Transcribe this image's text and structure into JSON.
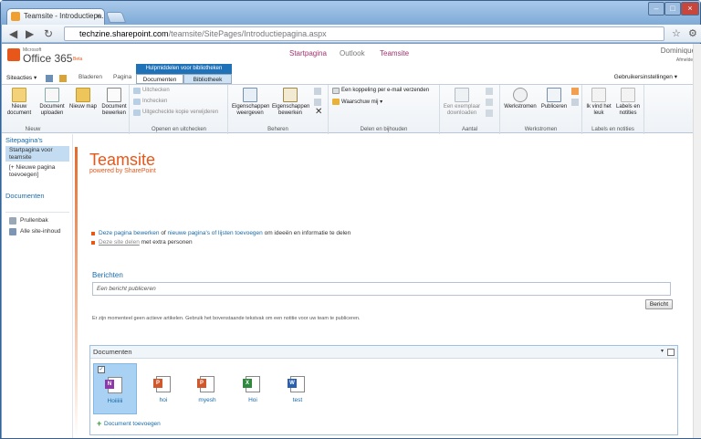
{
  "browser": {
    "tab_title": "Teamsite - Introductiepa...",
    "url_domain": "techzine.sharepoint.com",
    "url_path": "/teamsite/SitePages/Introductiepagina.aspx"
  },
  "o365": {
    "ms_label": "Microsoft",
    "product": "Office 365",
    "beta": "Beta",
    "nav": [
      "Startpagina",
      "Outlook",
      "Teamsite"
    ],
    "user_name": "Dominique",
    "signout": "Afmelden"
  },
  "ribbon_tabs": {
    "siteacties": "Siteacties",
    "bladeren": "Bladeren",
    "pagina": "Pagina",
    "context_group": "Hulpmiddelen voor bibliotheken",
    "documenten": "Documenten",
    "bibliotheek": "Bibliotheek",
    "user_settings": "Gebruikersinstellingen"
  },
  "ribbon": {
    "nieuw_doc": "Nieuw document",
    "doc_uploaden": "Document uploaden",
    "nieuw_map": "Nieuw map",
    "doc_bewerken": "Document bewerken",
    "uitchecken": "Uitchecken",
    "inchecken": "Inchecken",
    "uitgecheckt": "Uitgecheckte kopie verwijderen",
    "eig_weergeven": "Eigenschappen weergeven",
    "eig_bewerken": "Eigenschappen bewerken",
    "koppeling": "Een koppeling per e-mail verzenden",
    "waarschuw": "Waarschuw mij",
    "exemplaar": "Een exemplaar downloaden",
    "werkstromen": "Werkstromen",
    "publiceren": "Publiceren",
    "leuk": "Ik vind het leuk",
    "labels": "Labels en notities",
    "groups": {
      "nieuw": "Nieuw",
      "openen": "Openen en uitchecken",
      "beheren": "Beheren",
      "delen": "Delen en bijhouden",
      "aantal": "Aantal",
      "werkstromen": "Werkstromen",
      "labels": "Labels en notities"
    }
  },
  "left_nav": {
    "sitepaginas": "Sitepagina's",
    "startpagina": "Startpagina voor teamsite",
    "nieuwe_pagina": "[+ Nieuwe pagina toevoegen]",
    "documenten": "Documenten",
    "prullenbak": "Prullenbak",
    "alle": "Alle site-inhoud"
  },
  "main": {
    "title": "Teamsite",
    "powered": "powered by SharePoint",
    "bullet1_link1": "Deze pagina bewerken",
    "bullet1_of": "of",
    "bullet1_link2": "nieuwe pagina's of lijsten toevoegen",
    "bullet1_rest": "om ideeën en informatie te delen",
    "bullet2_link": "Deze site delen",
    "bullet2_rest": "met extra personen",
    "berichten": "Berichten",
    "bericht_placeholder": "Een bericht publiceren",
    "bericht_btn": "Bericht",
    "bericht_note": "Er zijn momenteel geen actieve artikelen. Gebruik het bovenstaande tekstvak om een notitie voor uw team te publiceren.",
    "documenten": "Documenten",
    "add_doc": "Document toevoegen",
    "docs": [
      {
        "name": "Hoiiiiii",
        "type": "onenote"
      },
      {
        "name": "hoi",
        "type": "powerpoint"
      },
      {
        "name": "myesh",
        "type": "powerpoint"
      },
      {
        "name": "Hoi",
        "type": "excel"
      },
      {
        "name": "test",
        "type": "word"
      }
    ]
  },
  "colors": {
    "accent": "#e7571a",
    "link": "#1a6aa8",
    "ribbon_blue": "#1f72b8"
  }
}
